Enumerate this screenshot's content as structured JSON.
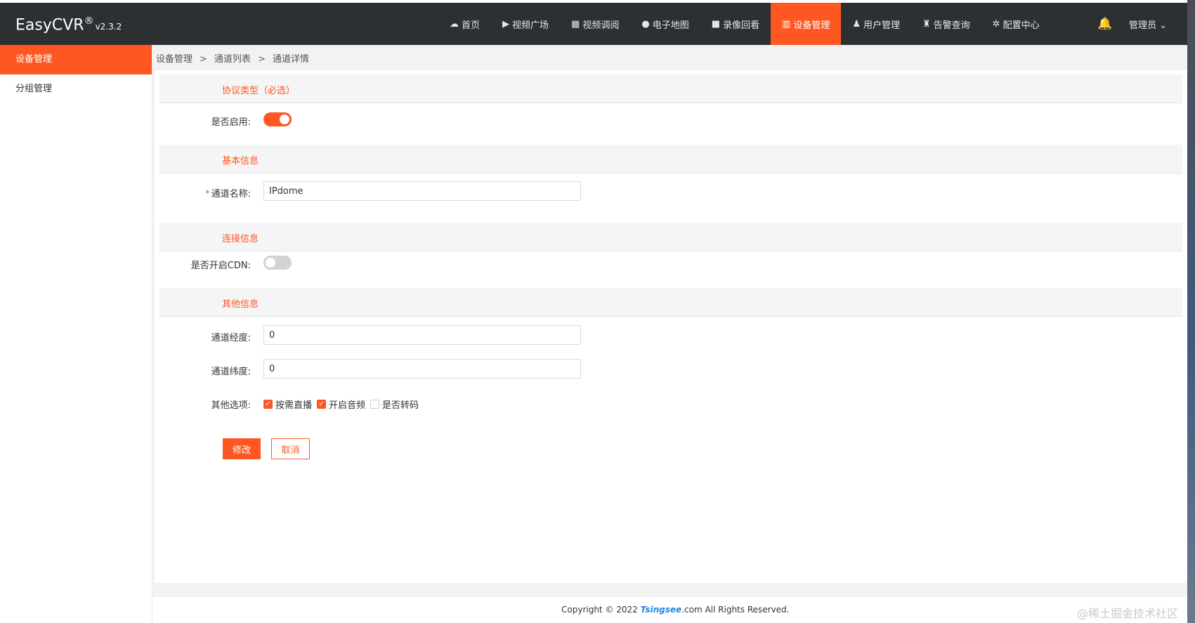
{
  "app": {
    "name": "EasyCVR",
    "reg": "®",
    "version": "v2.3.2"
  },
  "nav": [
    {
      "icon": "☁",
      "label": "首页",
      "active": false
    },
    {
      "icon": "▶",
      "label": "视频广场",
      "active": false
    },
    {
      "icon": "▦",
      "label": "视频调阅",
      "active": false
    },
    {
      "icon": "●",
      "label": "电子地图",
      "active": false
    },
    {
      "icon": "■",
      "label": "录像回看",
      "active": false
    },
    {
      "icon": "▥",
      "label": "设备管理",
      "active": true
    },
    {
      "icon": "♟",
      "label": "用户管理",
      "active": false
    },
    {
      "icon": "♜",
      "label": "告警查询",
      "active": false
    },
    {
      "icon": "✲",
      "label": "配置中心",
      "active": false
    }
  ],
  "user": {
    "bell_icon": "🔔",
    "name": "管理员",
    "caret": "⌄"
  },
  "sidebar": {
    "items": [
      {
        "label": "设备管理",
        "active": true
      },
      {
        "label": "分组管理",
        "active": false
      }
    ]
  },
  "breadcrumb": {
    "items": [
      "设备管理",
      "通道列表",
      "通道详情"
    ],
    "sep": ">"
  },
  "form": {
    "sections": {
      "protocol": "协议类型（必选）",
      "basic": "基本信息",
      "connection": "连接信息",
      "other": "其他信息"
    },
    "enabled": {
      "label": "是否启用:",
      "on": true
    },
    "channel_name": {
      "required": "*",
      "label": "通道名称:",
      "value": "IPdome"
    },
    "cdn": {
      "label": "是否开启CDN:",
      "on": false
    },
    "longitude": {
      "label": "通道经度:",
      "value": "0"
    },
    "latitude": {
      "label": "通道纬度:",
      "value": "0"
    },
    "options": {
      "label": "其他选项:",
      "items": [
        {
          "label": "按需直播",
          "checked": true
        },
        {
          "label": "开启音频",
          "checked": true
        },
        {
          "label": "是否转码",
          "checked": false
        }
      ]
    },
    "submit_label": "修改",
    "cancel_label": "取消"
  },
  "footer": {
    "prefix": "Copyright © 2022 ",
    "brand": "Tsingsee",
    "suffix": ".com All Rights Reserved."
  },
  "watermark": "@稀土掘金技术社区",
  "colors": {
    "accent": "#ff5722",
    "topbar": "#2d3033"
  }
}
